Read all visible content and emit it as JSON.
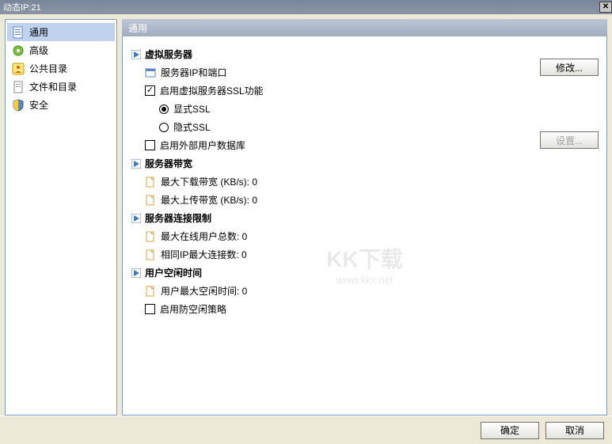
{
  "window": {
    "title": "动态IP:21"
  },
  "sidebar": {
    "items": [
      {
        "label": "通用",
        "icon": "page"
      },
      {
        "label": "高级",
        "icon": "gear"
      },
      {
        "label": "公共目录",
        "icon": "public"
      },
      {
        "label": "文件和目录",
        "icon": "file"
      },
      {
        "label": "安全",
        "icon": "shield"
      }
    ]
  },
  "content": {
    "header": "通用",
    "sections": {
      "virtual_server": {
        "title": "虚拟服务器",
        "server_ip_port": "服务器IP和端口",
        "enable_ssl": "启用虚拟服务器SSL功能",
        "explicit_ssl": "显式SSL",
        "implicit_ssl": "隐式SSL",
        "enable_external_user_db": "启用外部用户数据库",
        "modify_btn": "修改...",
        "settings_btn": "设置..."
      },
      "bandwidth": {
        "title": "服务器带宽",
        "max_download": "最大下载带宽 (KB/s): 0",
        "max_upload": "最大上传带宽 (KB/s): 0"
      },
      "connection_limit": {
        "title": "服务器连接限制",
        "max_online_users": "最大在线用户总数: 0",
        "same_ip_max": "相同IP最大连接数: 0"
      },
      "idle": {
        "title": "用户空闲时间",
        "max_idle": "用户最大空闲时间: 0",
        "enable_anti_idle": "启用防空闲策略"
      }
    }
  },
  "footer": {
    "ok": "确定",
    "cancel": "取消"
  },
  "watermark": {
    "main": "KK下载",
    "sub": "www.kkx.net"
  }
}
